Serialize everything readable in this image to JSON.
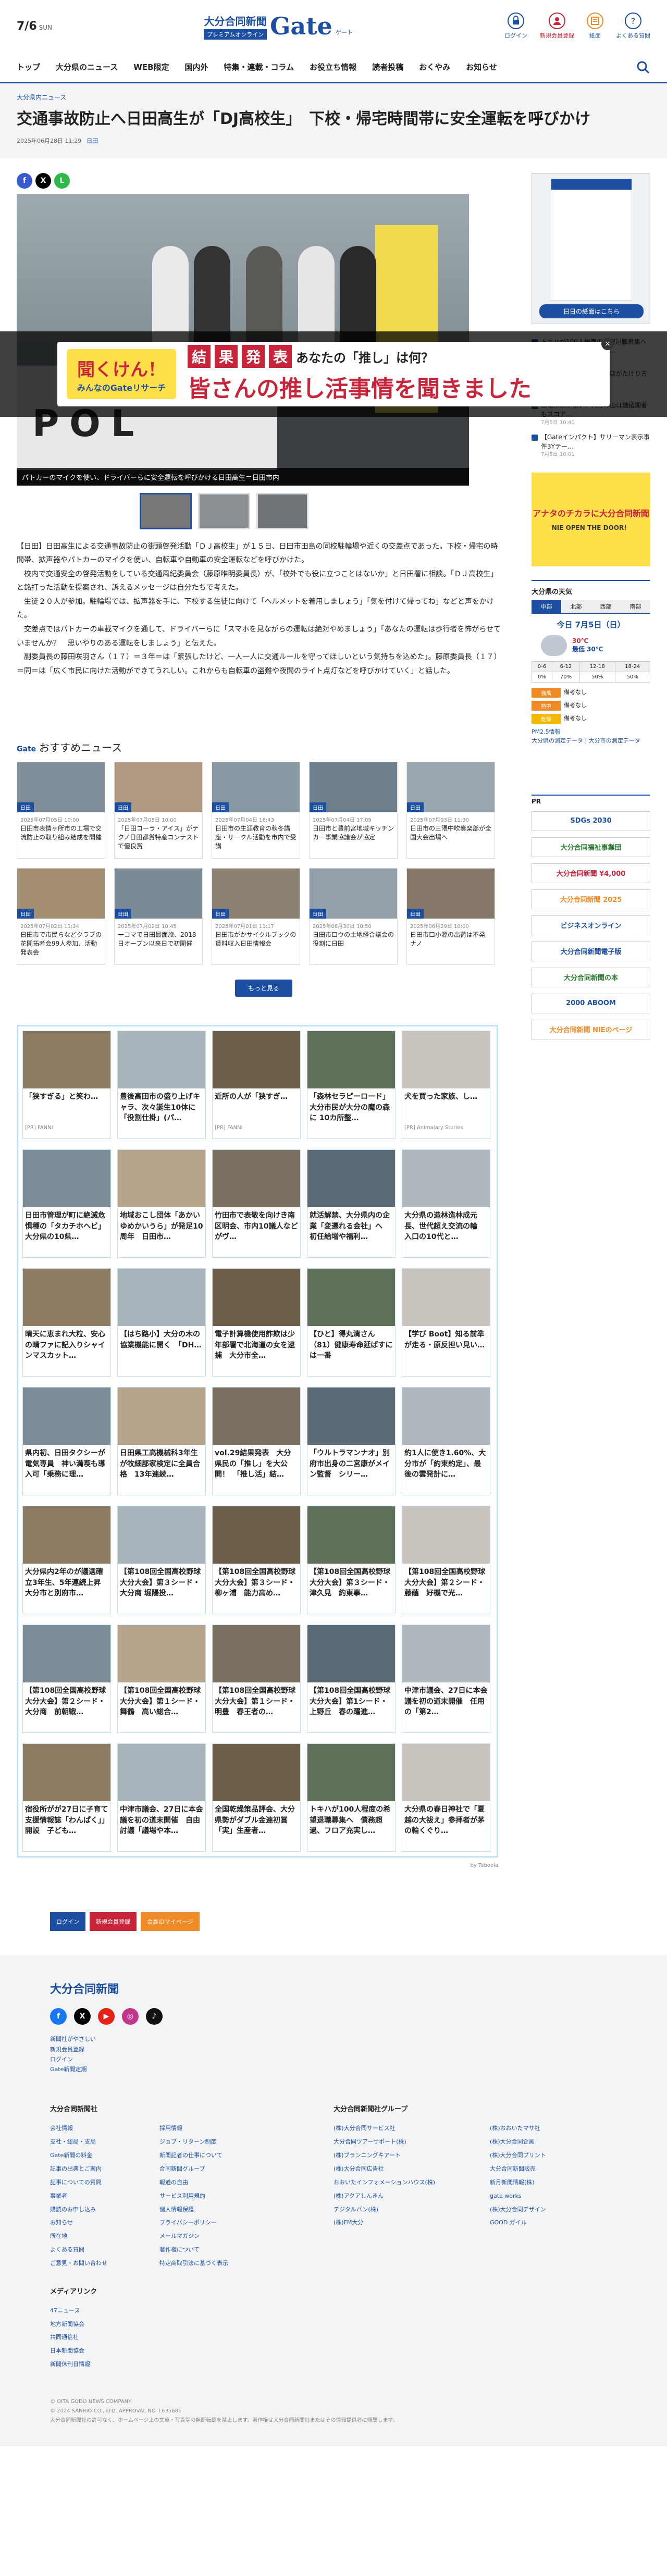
{
  "header": {
    "date_big": "7/6",
    "date_small": "SUN",
    "brand_name": "大分合同新聞",
    "brand_sub": "プレミアムオンライン",
    "brand_gate": "Gate",
    "brand_gate_sub": "ゲート",
    "util": [
      "ログイン",
      "新規会員登録",
      "紙面",
      "よくある質問"
    ]
  },
  "nav": [
    "トップ",
    "大分県のニュース",
    "WEB限定",
    "国内外",
    "特集・連載・コラム",
    "お役立ち情報",
    "読者投稿",
    "おくやみ",
    "お知らせ"
  ],
  "breadcrumb": "大分県内ニュース",
  "article": {
    "title": "交通事故防止へ日田高生が「DJ高校生」　下校・帰宅時間帯に安全運転を呼びかけ",
    "date": "2025年06月28日 11:29",
    "area": "日田",
    "caption": "パトカーのマイクを使い、ドライバーらに安全運転を呼びかける日田高生＝日田市内",
    "paragraphs": [
      "【日田】日田高生による交通事故防止の街頭啓発活動「ＤＪ高校生」が１５日、日田市田島の同校駐輪場や近くの交差点であった。下校・帰宅の時間帯、拡声器やパトカーのマイクを使い、自転車や自動車の安全運転などを呼びかけた。",
      "　校内で交通安全の啓発活動をしている交通風紀委員会（藤原唯明委員長）が、「校外でも役に立つことはないか」と日田署に相談。「ＤＪ高校生」と銘打った活動を提案され、訴えるメッセージは自分たちで考えた。",
      "　生徒２０人が参加。駐輪場では、拡声器を手に、下校する生徒に向けて「ヘルメットを着用しましょう」「気を付けて帰ってね」などと声をかけた。",
      "　交差点ではパトカーの車載マイクを通して、ドライバーらに「スマホを見ながらの運転は絶対やめましょう」「あなたの運転は歩行者を怖がらせていませんか？　思いやりのある運転をしましょう」と伝えた。",
      "　副委員長の藤田咲羽さん（１７）＝３年＝は「緊張したけど、一人一人に交通ルールを守ってほしいという気持ちを込めた」。藤原委員長（１７）＝同＝は「広く市民に向けた活動ができてうれしい。これからも自転車の盗難や夜間のライト点灯などを呼びかけていく」と話した。"
    ]
  },
  "ad": {
    "logo_line1": "聞くけん！",
    "logo_line2": "みんなのGateリサーチ",
    "boxes": [
      "結",
      "果",
      "発",
      "表"
    ],
    "question": "あなたの「推し」は何？",
    "headline": "皆さんの推し活事情を聞きました",
    "close": "×"
  },
  "recommend": {
    "gate": "Gate",
    "title": "おすすめニュース",
    "more": "もっと見る",
    "items": [
      {
        "tag": "日田",
        "date": "2025年07月05日 10:00",
        "text": "日田市表情ヶ所市の工場で交流防止の取り組み結成を開催"
      },
      {
        "tag": "日田",
        "date": "2025年07月05日 10:00",
        "text": "「日田コーラ・アイス」がテクノ日田都賞特産コンテストで優良賞"
      },
      {
        "tag": "日田",
        "date": "2025年07月04日 16:43",
        "text": "日田市の生涯教育の秋冬講座・サークル活動を市内で受講"
      },
      {
        "tag": "日田",
        "date": "2025年07月04日 17:09",
        "text": "日田市と豊前宮地域キッチンカー事業協議会が協定"
      },
      {
        "tag": "日田",
        "date": "2025年07月03日 11:30",
        "text": "日田市の三隈中吹奏楽部が全国大会出場へ"
      },
      {
        "tag": "日田",
        "date": "2025年07月02日 11:34",
        "text": "日田市で市民らなどクラブの花開拓者会99人参加、活動発表会"
      },
      {
        "tag": "日田",
        "date": "2025年07月02日 10:45",
        "text": "一コマで日田最面旅、2018日オープン以来日で初開催"
      },
      {
        "tag": "日田",
        "date": "2025年07月01日 11:17",
        "text": "日田市がかサイクルブックの賃料収入日田情報会"
      },
      {
        "tag": "日田",
        "date": "2025年06月30日 10:50",
        "text": "日田市口ウの土地経合議会の役割に日田"
      },
      {
        "tag": "日田",
        "date": "2025年06月29日 10:00",
        "text": "日田市口小源の出荷は不発ナノ"
      }
    ]
  },
  "taboola": {
    "by": "by Taboola",
    "items": [
      {
        "text": "「狭すぎる」と笑わ…",
        "src": "[PR] FANNI"
      },
      {
        "text": "豊後高田市の盛り上げキャラ、次々誕生10体に「役割仕掛」(パ…",
        "src": ""
      },
      {
        "text": "近所の人が「狭すぎ…",
        "src": "[PR] FANNI"
      },
      {
        "text": "「森林セラピーロード」大分市民が大分の魔の森に 10カ所整…",
        "src": ""
      },
      {
        "text": "犬を買った家族、し…",
        "src": "[PR] Animalary Stories"
      },
      {
        "text": "日田市管理が町に絶滅危惧種の「タカチホヘビ」　大分県の10県…",
        "src": ""
      },
      {
        "text": "地域おこし団体「あかいゆめかいうら」が発足10周年　日田市…",
        "src": ""
      },
      {
        "text": "竹田市で表敬を向けき南区明会、市内10議人などがヴ…",
        "src": ""
      },
      {
        "text": "就活解禁、大分県内の企業「変遷れる会社」へ　初任給増や福利…",
        "src": ""
      },
      {
        "text": "大分県の造林造林成元長、世代超え交流の輪　入口の10代と…",
        "src": ""
      },
      {
        "text": "晴天に恵まれ大粒、安心の晴ファに記入りシャインマスカット…",
        "src": ""
      },
      {
        "text": "【はち路小】大分の木の協業機能に開く　「DH…",
        "src": ""
      },
      {
        "text": "電子計算機使用詐欺は少年部署で北海道の女を逮捕　大分市全…",
        "src": ""
      },
      {
        "text": "【ひと】得丸清さん（81）健康寿命延ばすには一番",
        "src": ""
      },
      {
        "text": "【学び Boot】知る前準が走る・原反担い見い…",
        "src": ""
      },
      {
        "text": "県内初、日田タクシーが電気専員　神い満喫も導入可「乗務に理…",
        "src": ""
      },
      {
        "text": "日田県工高機械科3年生が牧細部家検定に全員合格　13年連続…",
        "src": ""
      },
      {
        "text": "vol.29結果発表　大分県民の「推し」を大公開！　「推し活」結…",
        "src": ""
      },
      {
        "text": "「ウルトラマンナオ」別府市出身の二宮康がメイン監督　シリー…",
        "src": ""
      },
      {
        "text": "約1人に使き1.60%、大分市が「約束約定」、最後の雲発計に…",
        "src": ""
      },
      {
        "text": "大分県内2年のが議選確立3年生、5年連続上昇　大分市と別府市…",
        "src": ""
      },
      {
        "text": "【第108回全国高校野球大分大会】第３シード・大分商 堀陽投…",
        "src": ""
      },
      {
        "text": "【第108回全国高校野球大分大会】第３シード・柳ヶ浦　能力高め…",
        "src": ""
      },
      {
        "text": "【第108回全国高校野球大分大会】第３シード・津久見　約東事…",
        "src": ""
      },
      {
        "text": "【第108回全国高校野球大分大会】第２シード・藤蔭　好機で光…",
        "src": ""
      },
      {
        "text": "【第108回全国高校野球大分大会】第２シード・大分商　前朝戦…",
        "src": ""
      },
      {
        "text": "【第108回全国高校野球大分大会】第１シード・舞鶴　高い総合…",
        "src": ""
      },
      {
        "text": "【第108回全国高校野球大分大会】第１シード・明豊　春王者の…",
        "src": ""
      },
      {
        "text": "【第108回全国高校野球大分大会】第1シード・上野丘　春の躍進…",
        "src": ""
      },
      {
        "text": "中津市議会、27日に本会議を初の道末開催　任用の「第2…",
        "src": ""
      },
      {
        "text": "宿役所がが27日に子育て支援情報誌「わんぱく」」開設　子ども…",
        "src": ""
      },
      {
        "text": "中津市議会、27日に本会議を初の道末開催　自由討議「議場や本…",
        "src": ""
      },
      {
        "text": "全国乾燥策品評会、大分県勢がダブル金連初賞　「実」生産者…",
        "src": ""
      },
      {
        "text": "トキハが100人程度の希望退職募集へ　債務超過、フロア充実し…",
        "src": ""
      },
      {
        "text": "大分県の春日神社で「夏越の大祓え」参拝者が茅の輪くぐり…",
        "src": ""
      }
    ]
  },
  "sidebar": {
    "paper_btn": "日日の紙面はこちら",
    "list": [
      {
        "text": "トキハが100人程度の希望退職募集へ　債務超過、フロア充実し…",
        "time": "7月5日 10:03"
      },
      {
        "text": "お中元商戦、大分県内各店がたけり方一等に大幅…",
        "time": "7月5日 10:10"
      },
      {
        "text": "恐竜未来が愉い、大分の山は建造期者もスコア…",
        "time": "7月5日 10:40"
      },
      {
        "text": "【Gateインパクト】サリーマン表示事件3Yテー…",
        "time": "7月5日 10:01"
      }
    ],
    "side_ad": "アナタのチカラに大分合同新聞",
    "side_ad_sub": "NIE OPEN THE DOOR！",
    "weather": {
      "title": "大分県の天気",
      "tabs": [
        "中部",
        "北部",
        "西部",
        "南部"
      ],
      "today": "今日 7月5日（日）",
      "hi": "30℃",
      "lo": "最低 30℃",
      "times": [
        "0-6",
        "6-12",
        "12-18",
        "18-24"
      ],
      "pops": [
        "0%",
        "70%",
        "50%",
        "50%"
      ],
      "labels": [
        "強風",
        "熱中",
        "乾燥"
      ],
      "values": [
        "備考なし",
        "備考なし",
        "備考なし"
      ],
      "pm": "PM2.5情報",
      "link": "大分県の測定データ | 大分市の測定データ"
    },
    "pr": "PR",
    "pr_banners": [
      {
        "text": "SDGs 2030",
        "color": "#1c4fa1"
      },
      {
        "text": "大分合同福祉事業団",
        "color": "#2e7d32"
      },
      {
        "text": "大分合同新聞 ¥4,000",
        "color": "#c8243a"
      },
      {
        "text": "大分合同新聞 2025",
        "color": "#f08a24"
      },
      {
        "text": "ビジネスオンライン",
        "color": "#1c4fa1"
      },
      {
        "text": "大分合同新聞電子版",
        "color": "#1c4fa1"
      },
      {
        "text": "大分合同新聞の本",
        "color": "#2e7d32"
      },
      {
        "text": "2000 ABOOM",
        "color": "#1c4fa1"
      },
      {
        "text": "大分合同新聞 NIEのページ",
        "color": "#f08a24"
      }
    ]
  },
  "member": [
    "ログイン",
    "新規会員登録",
    "会員IDマイページ"
  ],
  "footer": {
    "logo": "大分合同新聞",
    "small": [
      "新聞社がやさしい",
      "新規会員登録",
      "ログイン",
      "Gate新聞定期"
    ],
    "col1_title": "大分合同新聞社",
    "col1a": [
      "会社情報",
      "支社・総局・支局",
      "Gate新聞の料金",
      "記事の出典とご案内",
      "記事についての質問",
      "事業者",
      "購読のお申し込み",
      "お知らせ",
      "所在地",
      "よくある質問",
      "ご意見・お問い合わせ"
    ],
    "col1b": [
      "採用情報",
      "ジョブ・リターン制度",
      "新聞記者の仕事について",
      "合同新聞グループ",
      "報道の自由",
      "サービス利用規約",
      "個人情報保護",
      "プライバシーポリシー",
      "メールマガジン",
      "著作権について",
      "特定商取引法に基づく表示"
    ],
    "col2_title": "大分合同新聞社グループ",
    "col2a": [
      "(株)大分合同サービス社",
      "大分合同ツアーサポート(株)",
      "(株)ブランニングキアート",
      "(株)大分合同広告社",
      "おおいたインフォメーションハウス(株)",
      "(株)アクアしんきん",
      "デジタルバン(株)",
      "(株)FM大分"
    ],
    "col2b": [
      "(株)おおいたマサ社",
      "(株)大分合同企画",
      "(株)大分合同プリント",
      "大分合同新聞販売",
      "新月新聞情報(株)",
      "gate works",
      "(株)大分合同デザイン",
      "GOOD ガイル"
    ],
    "media_title": "メディアリンク",
    "media": [
      "47ニュース",
      "地方新聞協会",
      "共同通信社",
      "日本新聞協会",
      "新聞休刊日情報"
    ],
    "copy1": "© OITA GODO NEWS COMPANY",
    "copy2": "© 2024 SANRIO CO., LTD. APPROVAL NO. L635681",
    "copy3": "大分合同新聞社の許可なく、ホームページ上の文章・写真等の無断転載を禁止します。著作権は大分合同新聞社またはその情報提供者に帰属します。"
  },
  "colors": {
    "brand": "#1c4fa1",
    "accent": "#c8243a",
    "orange": "#f08a24"
  }
}
